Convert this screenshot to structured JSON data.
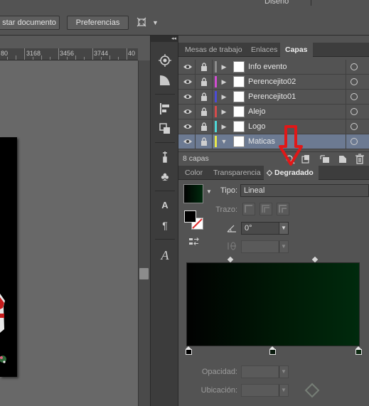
{
  "topbar": {
    "workspace_label": "Diseño",
    "place_document_label": "star documento",
    "preferences_label": "Preferencias"
  },
  "ruler": {
    "labels": [
      "80",
      "3168",
      "3456",
      "3744",
      "40"
    ]
  },
  "panel_collapse_glyph": "◂◂",
  "layers_panel": {
    "tabs": [
      "Mesas de trabajo",
      "Enlaces",
      "Capas"
    ],
    "active_tab": "Capas",
    "layers": [
      {
        "name": "Info evento",
        "color": "#8c8c8c",
        "expanded": false,
        "selected": false
      },
      {
        "name": "Perencejito02",
        "color": "#d14dd1",
        "expanded": false,
        "selected": false
      },
      {
        "name": "Perencejito01",
        "color": "#4b4bd6",
        "expanded": false,
        "selected": false
      },
      {
        "name": "Alejo",
        "color": "#d64b4b",
        "expanded": false,
        "selected": false
      },
      {
        "name": "Logo",
        "color": "#4fd8d8",
        "expanded": false,
        "selected": false
      },
      {
        "name": "Maticas",
        "color": "#e8e84b",
        "expanded": true,
        "selected": true
      }
    ],
    "count_label": "8 capas"
  },
  "gradient_panel": {
    "tabs": [
      "Color",
      "Transparencia",
      "Degradado"
    ],
    "active_tab": "Degradado",
    "tab_prefix_glyph": "◇",
    "type_label": "Tipo:",
    "type_value": "Lineal",
    "stroke_label": "Trazo:",
    "angle_value": "0°",
    "opacity_label": "Opacidad:",
    "location_label": "Ubicación:",
    "gradient_colors": [
      "#010101",
      "#001a06",
      "#002a0d"
    ]
  },
  "annotation": {
    "arrow_color": "#e01818"
  }
}
